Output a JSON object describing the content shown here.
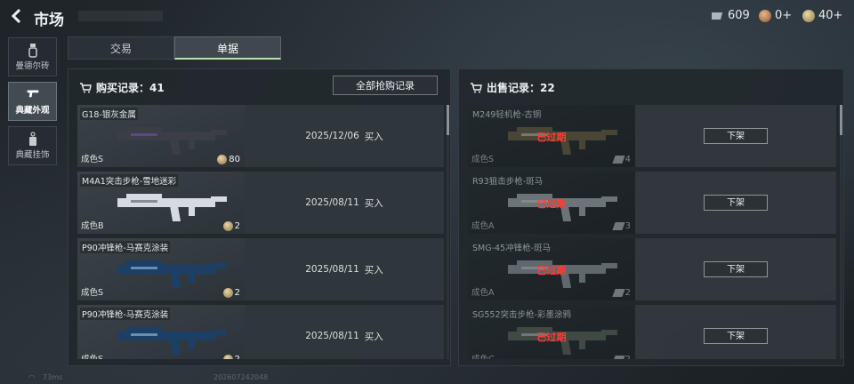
{
  "header": {
    "title": "市场",
    "currencies": [
      {
        "icon": "ticket-icon",
        "value": "609",
        "color": "#aeb6ba"
      },
      {
        "icon": "medal-icon",
        "value": "0+",
        "color": "#c48c61"
      },
      {
        "icon": "coin-icon",
        "value": "40+",
        "color": "#c9b27c"
      }
    ]
  },
  "sidebar": {
    "items": [
      {
        "icon": "bottle-icon",
        "label": "曼德尔砖",
        "active": false
      },
      {
        "icon": "pistol-icon",
        "label": "典藏外观",
        "active": true
      },
      {
        "icon": "pendant-icon",
        "label": "典藏挂饰",
        "active": false
      }
    ]
  },
  "tabs": [
    {
      "label": "交易",
      "active": false
    },
    {
      "label": "单据",
      "active": true
    }
  ],
  "buy_panel": {
    "title": "购买记录：41",
    "button": "全部抢购记录",
    "rows": [
      {
        "name": "G18-银灰金属",
        "grade": "成色S",
        "count": "80",
        "date": "2025/12/06",
        "action": "买入",
        "weapon_color": "#3b3e44",
        "accent": "#7a4fb8"
      },
      {
        "name": "M4A1突击步枪-雪地迷彩",
        "grade": "成色B",
        "count": "2",
        "date": "2025/08/11",
        "action": "买入",
        "weapon_color": "#d5dbe0",
        "accent": "#505a63"
      },
      {
        "name": "P90冲锋枪-马赛克涂装",
        "grade": "成色S",
        "count": "2",
        "date": "2025/08/11",
        "action": "买入",
        "weapon_color": "#1c3f66",
        "accent": "#9cc2e0"
      },
      {
        "name": "P90冲锋枪-马赛克涂装",
        "grade": "成色S",
        "count": "2",
        "date": "2025/08/11",
        "action": "买入",
        "weapon_color": "#1c3f66",
        "accent": "#9cc2e0"
      }
    ]
  },
  "sell_panel": {
    "title": "出售记录：22",
    "rows": [
      {
        "name": "M249轻机枪-古铜",
        "grade": "成色S",
        "count": "4",
        "status": "已过期",
        "button": "下架",
        "weapon_color": "#4a4636"
      },
      {
        "name": "R93狙击步枪-斑马",
        "grade": "成色A",
        "count": "3",
        "status": "已过期",
        "button": "下架",
        "weapon_color": "#6b7478"
      },
      {
        "name": "SMG-45冲锋枪-斑马",
        "grade": "成色A",
        "count": "2",
        "status": "已过期",
        "button": "下架",
        "weapon_color": "#5f686c"
      },
      {
        "name": "SG552突击步枪-彩墨涂鸦",
        "grade": "成色C",
        "count": "2",
        "status": "已过期",
        "button": "下架",
        "weapon_color": "#3f4a45"
      }
    ]
  },
  "footer": {
    "ping": "73ms",
    "build_id": "202607242048"
  }
}
